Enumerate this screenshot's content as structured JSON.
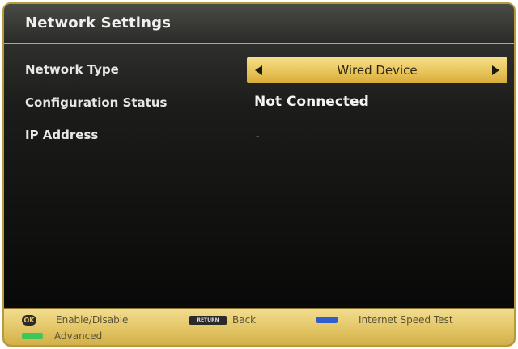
{
  "window": {
    "title": "Network Settings"
  },
  "rows": [
    {
      "label": "Network Type",
      "value": "Wired Device"
    },
    {
      "label": "Configuration Status",
      "value": "Not Connected"
    },
    {
      "label": "IP Address",
      "value": "-"
    }
  ],
  "footer": {
    "enable_disable": "Enable/Disable",
    "return_key": "RETURN",
    "back": "Back",
    "internet_speed_test": "Internet Speed Test",
    "advanced": "Advanced",
    "ok_key": "OK"
  },
  "colors": {
    "accent_gold": "#e4c768",
    "blue_key": "#2f5fcf",
    "green_key": "#3fc65a"
  }
}
